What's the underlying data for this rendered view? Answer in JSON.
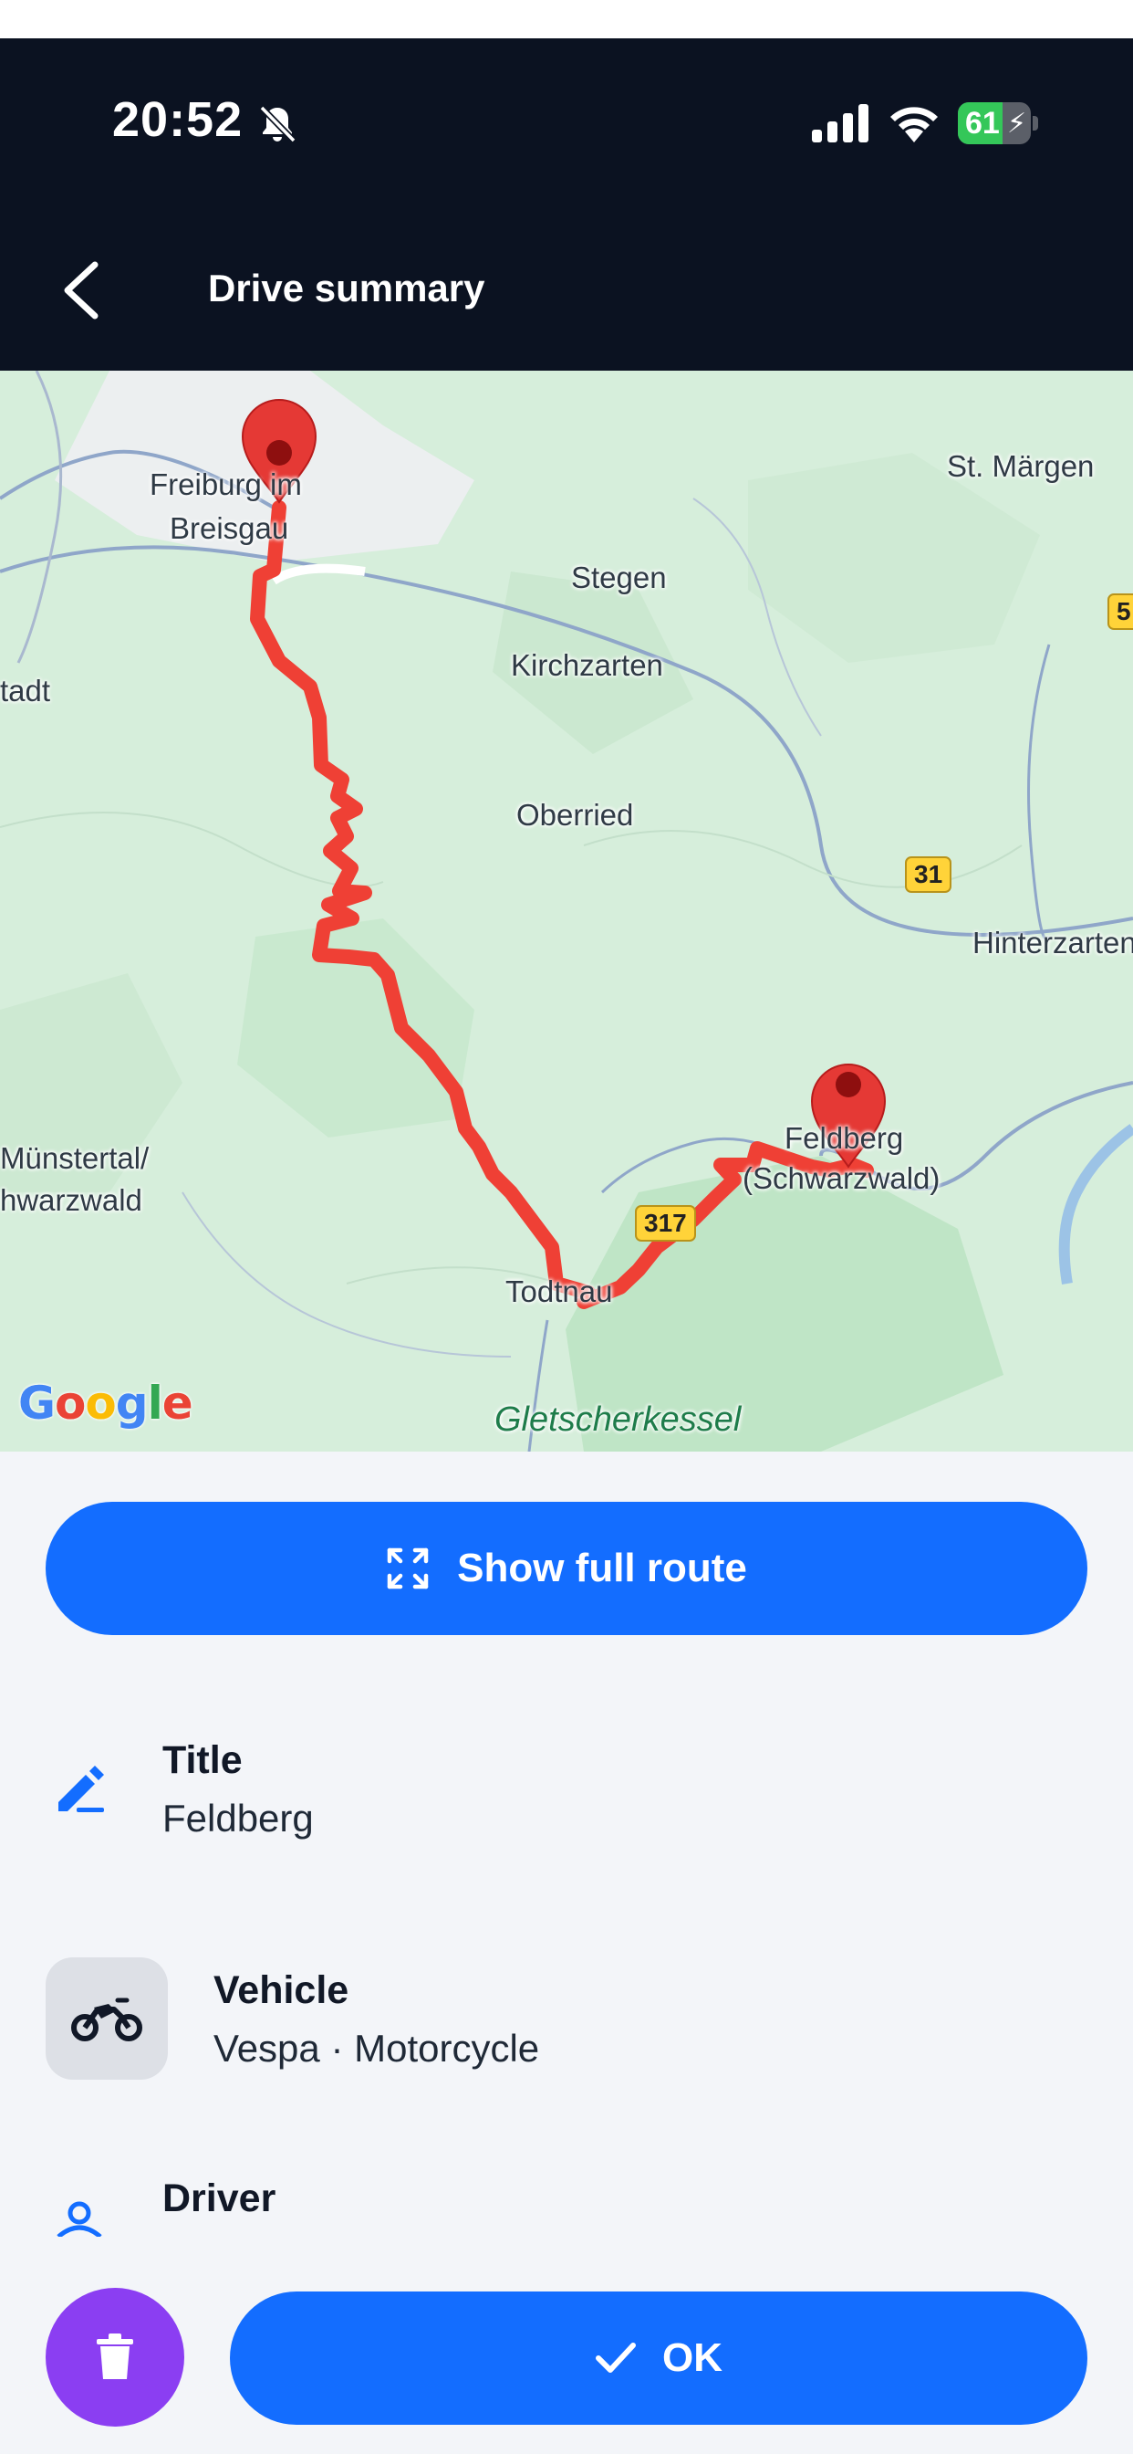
{
  "status_bar": {
    "time": "20:52",
    "battery_percent": "61",
    "battery_level": 0.61,
    "icons": [
      "bell-slash-icon",
      "signal-icon",
      "wifi-icon",
      "battery-charging-icon"
    ]
  },
  "nav": {
    "title": "Drive summary",
    "back_icon": "chevron-left-icon"
  },
  "map": {
    "places": {
      "freiburg": "Freiburg im Breisgau",
      "freiburg_line1": "Freiburg im",
      "freiburg_line2": "Breisgau",
      "st_margen": "St. Märgen",
      "stegen": "Stegen",
      "kirchzarten": "Kirchzarten",
      "oberried": "Oberried",
      "hinterzarten": "Hinterzarten",
      "stadt": "tadt",
      "munstertal_line1": "Münstertal/",
      "munstertal_line2": "hwarzwald",
      "feldberg_line1": "Feldberg",
      "feldberg_line2": "(Schwarzwald)",
      "todtnau": "Todtnau",
      "gletscherkessel": "Gletscherkessel"
    },
    "roads": [
      "31",
      "317",
      "5"
    ],
    "attribution": "Google",
    "route_color": "#ef4035",
    "marker_color": "#e53935",
    "markers": [
      "start-marker",
      "end-marker"
    ]
  },
  "actions": {
    "show_full_route": "Show full route",
    "ok": "OK"
  },
  "details": {
    "title_label": "Title",
    "title_value": "Feldberg",
    "vehicle_label": "Vehicle",
    "vehicle_value": "Vespa · Motorcycle",
    "driver_label": "Driver"
  },
  "colors": {
    "primary": "#136dff",
    "delete": "#8b3ef2",
    "header_bg": "#0b1221",
    "content_bg": "#f3f5f9"
  }
}
